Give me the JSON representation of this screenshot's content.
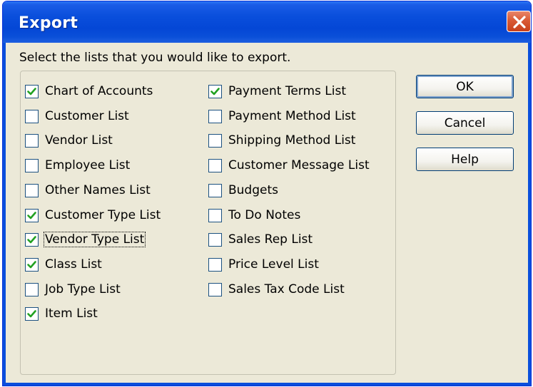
{
  "window": {
    "title": "Export",
    "close_icon": "close-icon",
    "close_color": "#d95a36",
    "titlebar_color": "#0a4fdc"
  },
  "instruction": "Select the lists that you would like to export.",
  "lists_left": [
    {
      "label": "Chart of Accounts",
      "checked": true
    },
    {
      "label": "Customer List",
      "checked": false
    },
    {
      "label": "Vendor List",
      "checked": false
    },
    {
      "label": "Employee List",
      "checked": false
    },
    {
      "label": "Other Names List",
      "checked": false
    },
    {
      "label": "Customer Type List",
      "checked": true
    },
    {
      "label": "Vendor Type List",
      "checked": true,
      "focused": true
    },
    {
      "label": "Class List",
      "checked": true
    },
    {
      "label": "Job Type List",
      "checked": false
    },
    {
      "label": "Item List",
      "checked": true
    }
  ],
  "lists_right": [
    {
      "label": "Payment Terms List",
      "checked": true
    },
    {
      "label": "Payment Method List",
      "checked": false
    },
    {
      "label": "Shipping Method List",
      "checked": false
    },
    {
      "label": "Customer Message List",
      "checked": false
    },
    {
      "label": "Budgets",
      "checked": false
    },
    {
      "label": "To Do Notes",
      "checked": false
    },
    {
      "label": "Sales Rep List",
      "checked": false
    },
    {
      "label": "Price Level List",
      "checked": false
    },
    {
      "label": "Sales Tax Code List",
      "checked": false
    }
  ],
  "buttons": {
    "ok": "OK",
    "cancel": "Cancel",
    "help": "Help"
  },
  "colors": {
    "dialog_bg": "#ece9d8",
    "check_mark": "#21a121"
  }
}
